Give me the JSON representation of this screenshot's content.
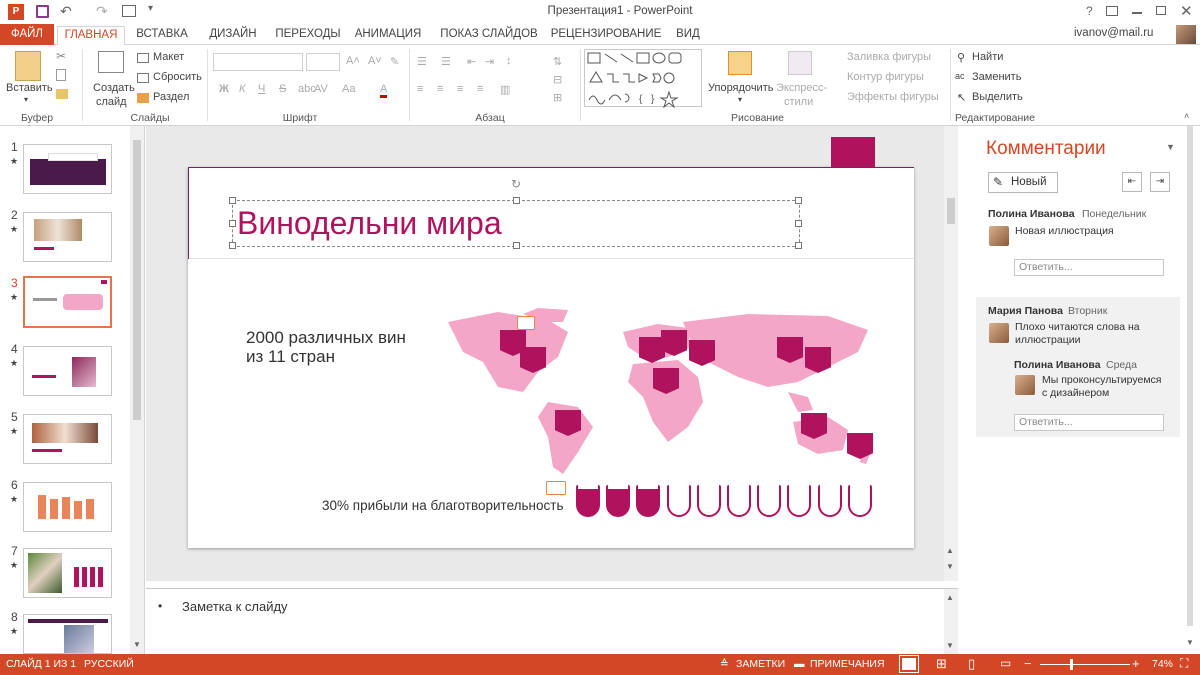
{
  "window": {
    "title": "Презентация1 - PowerPoint",
    "help": "?"
  },
  "tabs": [
    {
      "label": "ФАЙЛ"
    },
    {
      "label": "ГЛАВНАЯ"
    },
    {
      "label": "ВСТАВКА"
    },
    {
      "label": "ДИЗАЙН"
    },
    {
      "label": "ПЕРЕХОДЫ"
    },
    {
      "label": "АНИМАЦИЯ"
    },
    {
      "label": "ПОКАЗ СЛАЙДОВ"
    },
    {
      "label": "РЕЦЕНЗИРОВАНИЕ"
    },
    {
      "label": "ВИД"
    }
  ],
  "user": {
    "email": "ivanov@mail.ru"
  },
  "ribbon": {
    "clipboard": {
      "paste": "Вставить",
      "group": "Буфер обмена"
    },
    "slides": {
      "new_slide_1": "Создать",
      "new_slide_2": "слайд",
      "layout": "Макет",
      "reset": "Сбросить",
      "section": "Раздел",
      "group": "Слайды"
    },
    "font": {
      "bold": "Ж",
      "italic": "К",
      "underline": "Ч",
      "strike": "S",
      "spacing": "AV",
      "case": "Aa",
      "group": "Шрифт"
    },
    "paragraph": {
      "group": "Абзац"
    },
    "drawing": {
      "arrange": "Упорядочить",
      "quick_styles_1": "Экспресс-",
      "quick_styles_2": "стили",
      "fill": "Заливка фигуры",
      "outline": "Контур фигуры",
      "effects": "Эффекты фигуры",
      "group": "Рисование"
    },
    "editing": {
      "find": "Найти",
      "replace": "Заменить",
      "select": "Выделить",
      "group": "Редактирование"
    }
  },
  "thumbnails": [
    {
      "num": "1",
      "star": "★"
    },
    {
      "num": "2",
      "star": "★"
    },
    {
      "num": "3",
      "star": "★"
    },
    {
      "num": "4",
      "star": "★"
    },
    {
      "num": "5",
      "star": "★"
    },
    {
      "num": "6",
      "star": "★"
    },
    {
      "num": "7",
      "star": "★"
    },
    {
      "num": "8",
      "star": "★"
    }
  ],
  "slide": {
    "title": "Винодельни мира",
    "subtitle_1": "2000 различных вин",
    "subtitle_2": "из 11 стран",
    "charity": "30% прибыли на благотворительность",
    "glasses_total": 10,
    "glasses_filled": 3
  },
  "notes": {
    "text": "Заметка к слайду"
  },
  "comments": {
    "title": "Комментарии",
    "new_button": "Новый",
    "thread1": {
      "author": "Полина Иванова",
      "day": "Понедельник",
      "text": "Новая иллюстрация",
      "reply_placeholder": "Ответить..."
    },
    "thread2": {
      "author": "Мария Панова",
      "day": "Вторник",
      "text_1": "Плохо читаются слова на",
      "text_2": "иллюстрации",
      "reply_author": "Полина Иванова",
      "reply_day": "Среда",
      "reply_text_1": "Мы проконсультируемся",
      "reply_text_2": "с дизайнером",
      "reply_placeholder": "Ответить..."
    }
  },
  "status": {
    "slide": "СЛАЙД 1 ИЗ 1",
    "language": "РУССКИЙ",
    "notes": "ЗАМЕТКИ",
    "comments": "ПРИМЕЧАНИЯ",
    "zoom": "74%"
  },
  "colors": {
    "accent": "#d24726",
    "brand": "#b0135e",
    "map": "#f4a6c8"
  }
}
